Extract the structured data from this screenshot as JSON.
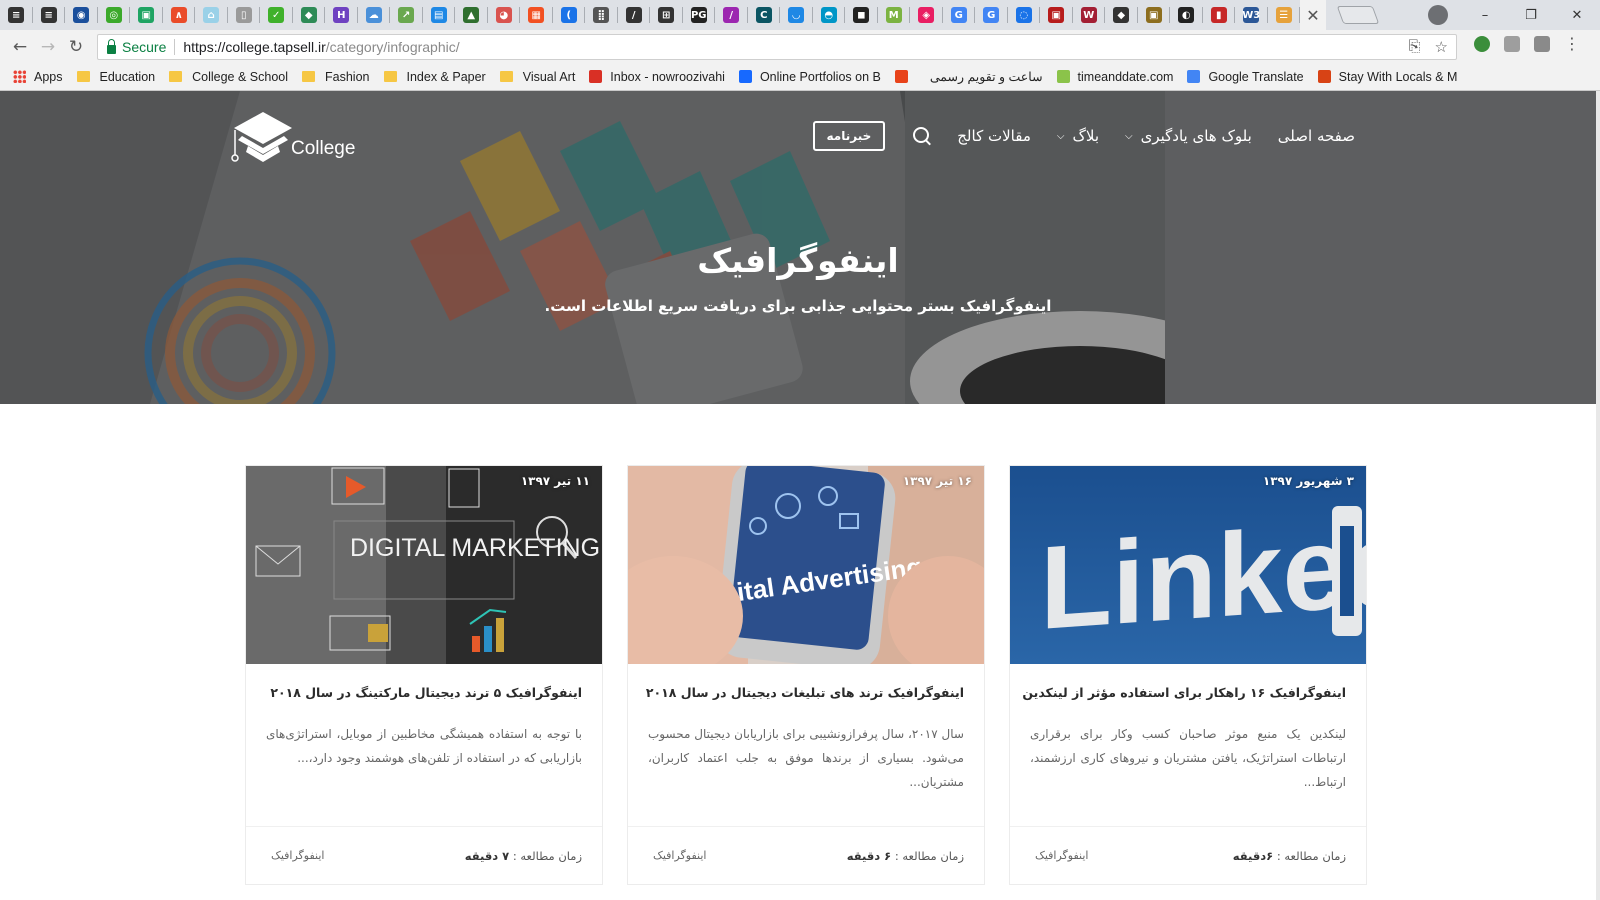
{
  "browser": {
    "tab_icons": [
      {
        "name": "tab-favicon-1",
        "color": "#333333",
        "glyph": "≡"
      },
      {
        "name": "tab-favicon-2",
        "color": "#333333",
        "glyph": "≡"
      },
      {
        "name": "tab-favicon-3",
        "color": "#1a4f9c",
        "glyph": "◉"
      },
      {
        "name": "tab-favicon-4",
        "color": "#3ba92b",
        "glyph": "◎"
      },
      {
        "name": "tab-favicon-5",
        "color": "#1fa463",
        "glyph": "▣"
      },
      {
        "name": "tab-favicon-6",
        "color": "#ea4c2a",
        "glyph": "∧"
      },
      {
        "name": "tab-favicon-7",
        "color": "#9ad1e8",
        "glyph": "⌂"
      },
      {
        "name": "tab-favicon-8",
        "color": "#9a9a9a",
        "glyph": "▯"
      },
      {
        "name": "tab-favicon-9",
        "color": "#3fb12b",
        "glyph": "✓"
      },
      {
        "name": "tab-favicon-10",
        "color": "#2e8b57",
        "glyph": "◆"
      },
      {
        "name": "tab-favicon-11",
        "color": "#6f42c1",
        "glyph": "H"
      },
      {
        "name": "tab-favicon-12",
        "color": "#4a90d9",
        "glyph": "☁"
      },
      {
        "name": "tab-favicon-13",
        "color": "#6aa84f",
        "glyph": "↗"
      },
      {
        "name": "tab-favicon-14",
        "color": "#1e88e5",
        "glyph": "▤"
      },
      {
        "name": "tab-favicon-15",
        "color": "#2f6f2f",
        "glyph": "▲"
      },
      {
        "name": "tab-favicon-16",
        "color": "#d9534f",
        "glyph": "◕"
      },
      {
        "name": "tab-favicon-17",
        "color": "#f25022",
        "glyph": "▦"
      },
      {
        "name": "tab-favicon-18",
        "color": "#1a73e8",
        "glyph": "("
      },
      {
        "name": "tab-favicon-19",
        "color": "#555555",
        "glyph": "⣿"
      },
      {
        "name": "tab-favicon-20",
        "color": "#333333",
        "glyph": "/"
      },
      {
        "name": "tab-favicon-21",
        "color": "#333333",
        "glyph": "⊞"
      },
      {
        "name": "tab-favicon-22",
        "color": "#222222",
        "glyph": "PG"
      },
      {
        "name": "tab-favicon-23",
        "color": "#9c27b0",
        "glyph": "/"
      },
      {
        "name": "tab-favicon-24",
        "color": "#0b5563",
        "glyph": "C"
      },
      {
        "name": "tab-favicon-25",
        "color": "#1e88e5",
        "glyph": "◡"
      },
      {
        "name": "tab-favicon-26",
        "color": "#0096c7",
        "glyph": "◓"
      },
      {
        "name": "tab-favicon-27",
        "color": "#222222",
        "glyph": "◼"
      },
      {
        "name": "tab-favicon-28",
        "color": "#7cb342",
        "glyph": "M"
      },
      {
        "name": "tab-favicon-29",
        "color": "#e91e63",
        "glyph": "◈"
      },
      {
        "name": "tab-favicon-30",
        "color": "#4285f4",
        "glyph": "G"
      },
      {
        "name": "tab-favicon-31",
        "color": "#4285f4",
        "glyph": "G"
      },
      {
        "name": "tab-favicon-32",
        "color": "#1a73e8",
        "glyph": "◌"
      },
      {
        "name": "tab-favicon-33",
        "color": "#b71c1c",
        "glyph": "▣"
      },
      {
        "name": "tab-favicon-34",
        "color": "#a31f34",
        "glyph": "W"
      },
      {
        "name": "tab-favicon-35",
        "color": "#333333",
        "glyph": "◆"
      },
      {
        "name": "tab-favicon-36",
        "color": "#8d6e1f",
        "glyph": "▣"
      },
      {
        "name": "tab-favicon-37",
        "color": "#222222",
        "glyph": "◐"
      },
      {
        "name": "tab-favicon-38",
        "color": "#c62828",
        "glyph": "▮"
      },
      {
        "name": "tab-favicon-39",
        "color": "#2b5797",
        "glyph": "W3"
      },
      {
        "name": "tab-favicon-40",
        "color": "#e6a23c",
        "glyph": "☰"
      }
    ],
    "active_tab_close": "✕",
    "window_controls": {
      "minimize": "–",
      "restore": "❐",
      "close": "✕"
    },
    "nav": {
      "back": "←",
      "forward": "→",
      "reload": "↻"
    },
    "secure_label": "Secure",
    "url_host": "https://college.tapsell.ir",
    "url_path": "/category/infographic/",
    "omnibox_icons": {
      "translate": "⎘",
      "star": "☆"
    },
    "bookmarks": [
      {
        "label": "Apps",
        "kind": "apps"
      },
      {
        "label": "Education",
        "kind": "folder"
      },
      {
        "label": "College & School",
        "kind": "folder"
      },
      {
        "label": "Fashion",
        "kind": "folder"
      },
      {
        "label": "Index & Paper",
        "kind": "folder"
      },
      {
        "label": "Visual Art",
        "kind": "folder"
      },
      {
        "label": "Inbox - nowroozivahi",
        "kind": "gmail",
        "color": "#d93025"
      },
      {
        "label": "Online Portfolios on B",
        "kind": "behance",
        "color": "#1769ff"
      },
      {
        "label": "",
        "kind": "site",
        "color": "#e8431a"
      },
      {
        "label": "ساعت و تقویم رسمی",
        "kind": "none"
      },
      {
        "label": "timeanddate.com",
        "kind": "site",
        "color": "#8bc34a"
      },
      {
        "label": "Google Translate",
        "kind": "site",
        "color": "#4285f4"
      },
      {
        "label": "Stay With Locals & M",
        "kind": "site",
        "color": "#d84315"
      }
    ]
  },
  "site": {
    "logo_text": "College",
    "menu": [
      {
        "label": "صفحه اصلی",
        "dropdown": false
      },
      {
        "label": "بلوک های یادگیری",
        "dropdown": true
      },
      {
        "label": "بلاگ",
        "dropdown": true
      },
      {
        "label": "مقالات کالج",
        "dropdown": false
      }
    ],
    "newsletter_label": "خبرنامه",
    "hero_title": "اینفوگرافیک",
    "hero_subtitle": "اینفوگرافیک بستر محتوایی جذابی برای دریافت سریع اطلاعات است."
  },
  "cards": [
    {
      "date": "۳ شهریور ۱۳۹۷",
      "image": "linkedin",
      "image_text": "Linked",
      "title": "اینفوگرافیک ۱۶ راهکار برای استفاده مؤثر از لینکدین",
      "excerpt": "لینکدین یک منبع موثر صاحبان کسب وکار برای برقراری ارتباطات استراتژیک، یافتن مشتریان و نیروهای کاری ارزشمند، ارتباط...",
      "read_time_label": "زمان مطالعه :",
      "read_time_value": "۶دقیقه",
      "category": "اینفوگرافیک"
    },
    {
      "date": "۱۶ تیر ۱۳۹۷",
      "image": "digital-advertising",
      "image_text": "Digital Advertising",
      "title": "اینفوگرافیک ترند های تبلیغات دیجیتال در سال ۲۰۱۸",
      "excerpt": "سال ۲۰۱۷، سال پرفرازونشیبی برای بازاریابان دیجیتال محسوب می‌شود. بسیاری از برندها موفق به جلب اعتماد کاربران، مشتریان...",
      "read_time_label": "زمان مطالعه :",
      "read_time_value": "۶ دقیقه",
      "category": "اینفوگرافیک"
    },
    {
      "date": "۱۱ تیر ۱۳۹۷",
      "image": "digital-marketing",
      "image_text": "DIGITAL MARKETING",
      "title": "اینفوگرافیک ۵ ترند دیجیتال مارکتینگ در سال ۲۰۱۸",
      "excerpt": "با توجه به استفاده همیشگی مخاطبین از موبایل، استراتژی‌های بازاریابی که در استفاده از تلفن‌های هوشمند وجود دارد،...",
      "read_time_label": "زمان مطالعه :",
      "read_time_value": "۷ دقیقه",
      "category": "اینفوگرافیک"
    }
  ]
}
